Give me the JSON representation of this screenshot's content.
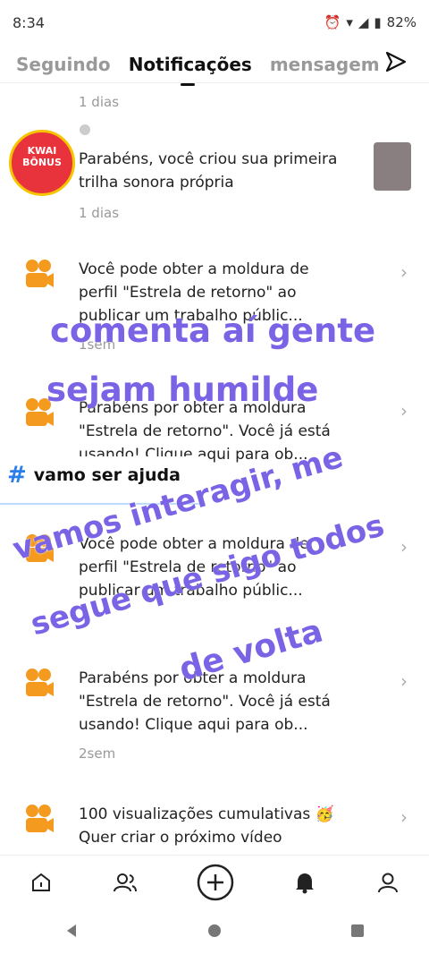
{
  "status": {
    "time": "8:34",
    "battery": "82%"
  },
  "tabs": {
    "following": "Seguindo",
    "notifications": "Notificações",
    "messages": "mensagem"
  },
  "feed": {
    "time0": "1 dias",
    "bonus_label": "KWAI\nBÔNUS",
    "n1": {
      "text": "Parabéns, você criou sua primeira trilha sonora própria",
      "time": "1 dias"
    },
    "n2": {
      "text": "Você pode obter a moldura de perfil \"Estrela de retorno\" ao publicar um trabalho públic...",
      "time": "1sem"
    },
    "n3": {
      "text": "Parabéns por obter a moldura \"Estrela de retorno\". Você já está usando! Clique aqui para ob..."
    },
    "n4": {
      "text": "Você pode obter a moldura de perfil \"Estrela de retorno\" ao publicar um trabalho públic..."
    },
    "n5": {
      "text": "Parabéns por obter a moldura \"Estrela de retorno\". Você já está usando! Clique aqui para ob...",
      "time": "2sem"
    },
    "n6": {
      "text": "100 visualizações cumulativas 🥳Quer criar o próximo vídeo"
    }
  },
  "overlay": {
    "line1": "comenta aí gente",
    "line2": "sejam humilde",
    "hashtag": "vamo ser ajuda",
    "diag1": "vamos interagir, me",
    "diag2": "segue que sigo todos",
    "diag3": "de volta"
  },
  "colors": {
    "accent": "#7b63e6",
    "kwai_orange": "#f39a1f"
  }
}
